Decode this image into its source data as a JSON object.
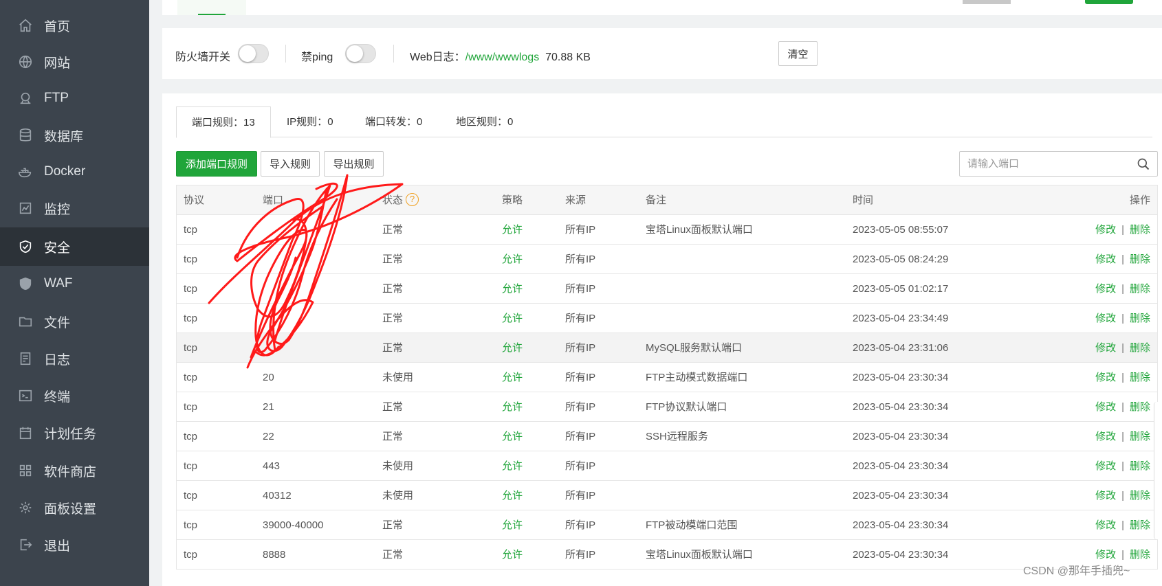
{
  "sidebar": {
    "items": [
      {
        "label": "首页",
        "icon": "home-icon"
      },
      {
        "label": "网站",
        "icon": "globe-icon"
      },
      {
        "label": "FTP",
        "icon": "ftp-icon"
      },
      {
        "label": "数据库",
        "icon": "database-icon"
      },
      {
        "label": "Docker",
        "icon": "docker-icon"
      },
      {
        "label": "监控",
        "icon": "monitor-icon"
      },
      {
        "label": "安全",
        "icon": "shield-icon",
        "active": true
      },
      {
        "label": "WAF",
        "icon": "waf-icon"
      },
      {
        "label": "文件",
        "icon": "folder-icon"
      },
      {
        "label": "日志",
        "icon": "log-icon"
      },
      {
        "label": "终端",
        "icon": "terminal-icon"
      },
      {
        "label": "计划任务",
        "icon": "calendar-icon"
      },
      {
        "label": "软件商店",
        "icon": "apps-icon"
      },
      {
        "label": "面板设置",
        "icon": "gear-icon"
      },
      {
        "label": "退出",
        "icon": "logout-icon"
      }
    ]
  },
  "firewall": {
    "switch_label": "防火墙开关",
    "ping_label": "禁ping",
    "weblog_label": "Web日志：",
    "weblog_path": "/www/wwwlogs",
    "weblog_size": "70.88 KB",
    "clear_label": "清空"
  },
  "tabs": [
    {
      "label": "端口规则：",
      "count": "13"
    },
    {
      "label": "IP规则：",
      "count": "0"
    },
    {
      "label": "端口转发：",
      "count": "0"
    },
    {
      "label": "地区规则：",
      "count": "0"
    }
  ],
  "toolbar": {
    "add_label": "添加端口规则",
    "import_label": "导入规则",
    "export_label": "导出规则",
    "search_placeholder": "请输入端口"
  },
  "table": {
    "headers": {
      "protocol": "协议",
      "port": "端口",
      "status": "状态",
      "policy": "策略",
      "source": "来源",
      "remark": "备注",
      "time": "时间",
      "ops": "操作"
    },
    "rows": [
      {
        "protocol": "tcp",
        "port": "",
        "status": "正常",
        "policy": "允许",
        "source": "所有IP",
        "remark": "宝塔Linux面板默认端口",
        "time": "2023-05-05 08:55:07"
      },
      {
        "protocol": "tcp",
        "port": "",
        "status": "正常",
        "policy": "允许",
        "source": "所有IP",
        "remark": "",
        "time": "2023-05-05 08:24:29"
      },
      {
        "protocol": "tcp",
        "port": "",
        "status": "正常",
        "policy": "允许",
        "source": "所有IP",
        "remark": "",
        "time": "2023-05-05 01:02:17"
      },
      {
        "protocol": "tcp",
        "port": "",
        "status": "正常",
        "policy": "允许",
        "source": "所有IP",
        "remark": "",
        "time": "2023-05-04 23:34:49"
      },
      {
        "protocol": "tcp",
        "port": "",
        "status": "正常",
        "policy": "允许",
        "source": "所有IP",
        "remark": "MySQL服务默认端口",
        "time": "2023-05-04 23:31:06"
      },
      {
        "protocol": "tcp",
        "port": "20",
        "status": "未使用",
        "policy": "允许",
        "source": "所有IP",
        "remark": "FTP主动模式数据端口",
        "time": "2023-05-04 23:30:34"
      },
      {
        "protocol": "tcp",
        "port": "21",
        "status": "正常",
        "policy": "允许",
        "source": "所有IP",
        "remark": "FTP协议默认端口",
        "time": "2023-05-04 23:30:34"
      },
      {
        "protocol": "tcp",
        "port": "22",
        "status": "正常",
        "policy": "允许",
        "source": "所有IP",
        "remark": "SSH远程服务",
        "time": "2023-05-04 23:30:34"
      },
      {
        "protocol": "tcp",
        "port": "443",
        "status": "未使用",
        "policy": "允许",
        "source": "所有IP",
        "remark": "",
        "time": "2023-05-04 23:30:34"
      },
      {
        "protocol": "tcp",
        "port": "40312",
        "status": "未使用",
        "policy": "允许",
        "source": "所有IP",
        "remark": "",
        "time": "2023-05-04 23:30:34"
      },
      {
        "protocol": "tcp",
        "port": "39000-40000",
        "status": "正常",
        "policy": "允许",
        "source": "所有IP",
        "remark": "FTP被动模端口范围",
        "time": "2023-05-04 23:30:34"
      },
      {
        "protocol": "tcp",
        "port": "8888",
        "status": "正常",
        "policy": "允许",
        "source": "所有IP",
        "remark": "宝塔Linux面板默认端口",
        "time": "2023-05-04 23:30:34"
      }
    ],
    "edit_label": "修改",
    "delete_label": "删除",
    "ops_separator": "|"
  },
  "watermark": "CSDN @那年手插兜~",
  "colors": {
    "accent": "#20a53a",
    "sidebar_bg": "#3c444d",
    "sidebar_active": "#2c3238",
    "help_icon": "#f0a020",
    "scribble": "#ff1a1a"
  }
}
